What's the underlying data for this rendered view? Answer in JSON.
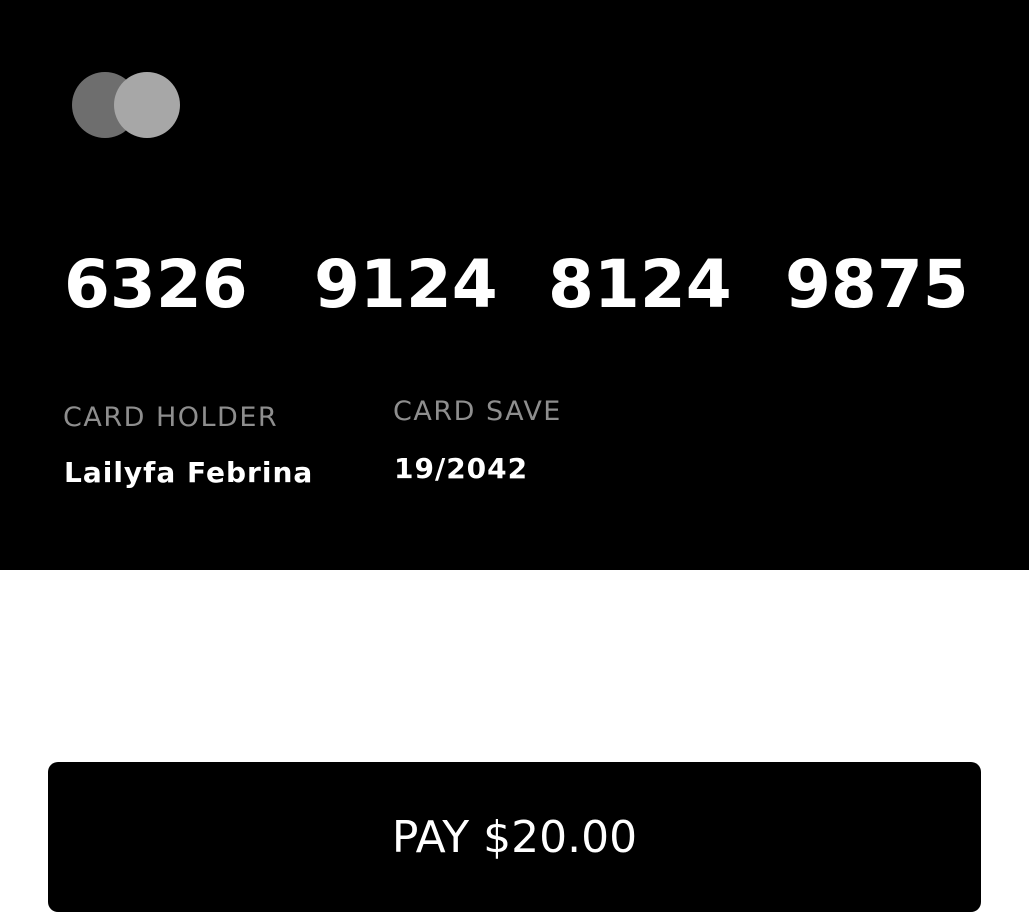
{
  "card": {
    "number_groups": [
      "6326",
      "9124",
      "8124",
      "9875"
    ],
    "holder_label": "CARD HOLDER",
    "holder_name": "Lailyfa Febrina",
    "save_label": "CARD SAVE",
    "save_value": "19/2042",
    "logo_icon": "card-network-logo-icon",
    "colors": {
      "background": "#000000",
      "logo_left": "#6e6e6e",
      "logo_right": "#a7a7a7",
      "label": "#8e8e8e",
      "text": "#ffffff"
    }
  },
  "pay_button": {
    "label": "PAY $20.00"
  }
}
